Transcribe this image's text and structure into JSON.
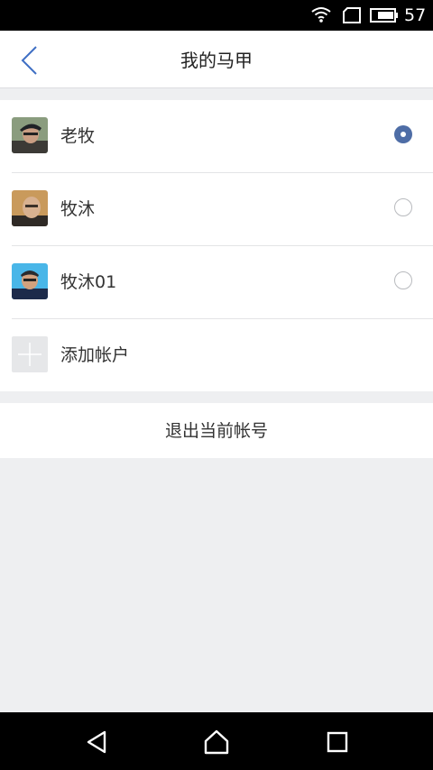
{
  "status_bar": {
    "battery_level": "57",
    "icons": [
      "wifi-icon",
      "sim-icon",
      "battery-icon"
    ]
  },
  "header": {
    "title": "我的马甲",
    "back_icon": "chevron-left-icon"
  },
  "accounts": [
    {
      "name": "老牧",
      "selected": true,
      "avatar": "avatar-laomu"
    },
    {
      "name": "牧沐",
      "selected": false,
      "avatar": "avatar-mumu"
    },
    {
      "name": "牧沐01",
      "selected": false,
      "avatar": "avatar-mumu01"
    }
  ],
  "add_account": {
    "label": "添加帐户",
    "icon": "plus-icon"
  },
  "logout": {
    "label": "退出当前帐号"
  },
  "nav_bar": {
    "icons": [
      "back-triangle-icon",
      "home-icon",
      "recents-square-icon"
    ]
  },
  "colors": {
    "accent": "#4e6da6",
    "back_arrow": "#3f6fc4",
    "background": "#eeeff1"
  }
}
